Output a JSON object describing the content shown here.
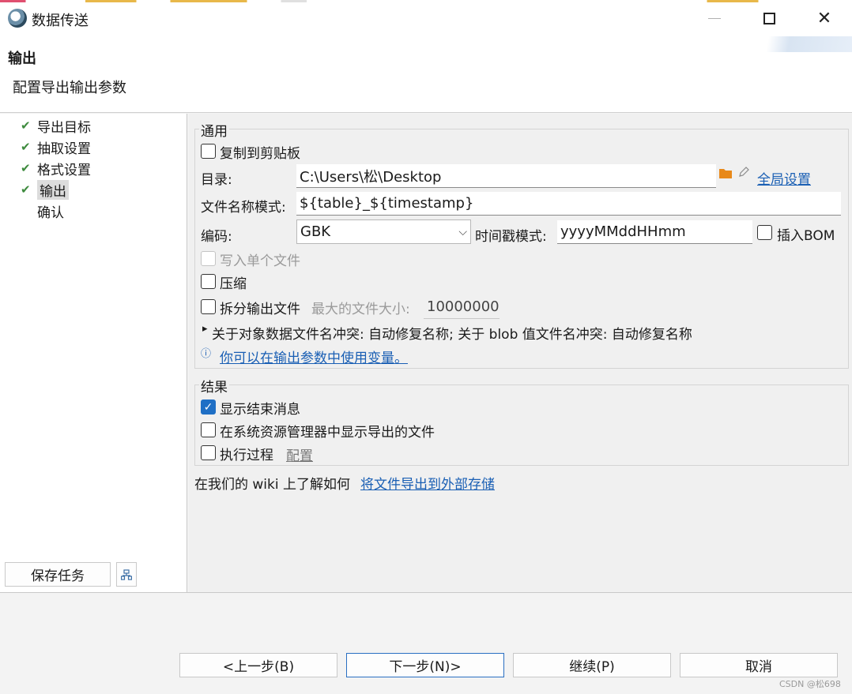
{
  "window": {
    "title": "数据传送",
    "minimize_label": "",
    "close_glyph": "✕"
  },
  "header": {
    "title": "输出",
    "description": "配置导出输出参数"
  },
  "nav": {
    "items": [
      {
        "label": "导出目标",
        "done": true
      },
      {
        "label": "抽取设置",
        "done": true
      },
      {
        "label": "格式设置",
        "done": true
      },
      {
        "label": "输出",
        "done": true,
        "active": true
      },
      {
        "label": "确认",
        "done": false
      }
    ],
    "check_glyph": "✔",
    "save_task_label": "保存任务",
    "small_icon": "task-config-icon"
  },
  "general": {
    "group_label": "通用",
    "copy_to_clipboard": {
      "label": "复制到剪贴板",
      "checked": false
    },
    "directory": {
      "label": "目录:",
      "value": "C:\\Users\\松\\Desktop",
      "global_settings_link": "全局设置"
    },
    "filename_pattern": {
      "label": "文件名称模式:",
      "value": "${table}_${timestamp}"
    },
    "encoding": {
      "label": "编码:",
      "value": "GBK",
      "caret": "⌵"
    },
    "timestamp_pattern": {
      "label": "时间戳模式:",
      "value": "yyyyMMddHHmm"
    },
    "insert_bom": {
      "label": "插入BOM",
      "checked": false
    },
    "write_single_file": {
      "label": "写入单个文件",
      "checked": false,
      "disabled": true
    },
    "compress": {
      "label": "压缩",
      "checked": false
    },
    "split_output": {
      "label": "拆分输出文件",
      "checked": false,
      "max_size_label": "最大的文件大小:",
      "max_size_value": "10000000"
    },
    "conflict_text": "关于对象数据文件名冲突: 自动修复名称; 关于 blob 值文件名冲突: 自动修复名称",
    "expand_glyph": "▸",
    "info_glyph": "ⓘ",
    "variables_link": "你可以在输出参数中使用变量。"
  },
  "results": {
    "group_label": "结果",
    "show_finish_message": {
      "label": "显示结束消息",
      "checked": true
    },
    "show_in_explorer": {
      "label": "在系统资源管理器中显示导出的文件",
      "checked": false
    },
    "execute_process": {
      "label": "执行过程",
      "checked": false,
      "config_link": "配置"
    }
  },
  "wiki": {
    "prefix": "在我们的 wiki 上了解如何",
    "link": "将文件导出到外部存储"
  },
  "footer": {
    "back_label": "<上一步(B)",
    "next_label": "下一步(N)>",
    "continue_label": "继续(P)",
    "cancel_label": "取消"
  },
  "watermark": "CSDN @松698",
  "colors": {
    "accent": "#1f6fc5",
    "link": "#1a5fb4",
    "check_green": "#3e8b3e",
    "folder_orange": "#e8891a"
  }
}
